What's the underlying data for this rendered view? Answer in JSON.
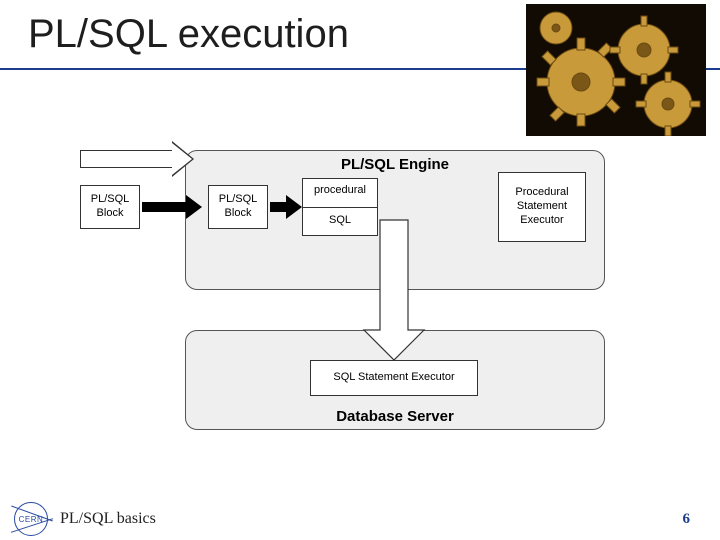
{
  "title": "PL/SQL execution",
  "engine": {
    "label": "PL/SQL Engine"
  },
  "db_server": {
    "label": "Database Server"
  },
  "outer_block": "PL/SQL\nBlock",
  "inner_block": "PL/SQL\nBlock",
  "split": {
    "top": "procedural",
    "bottom": "SQL"
  },
  "proc_exec": "Procedural\nStatement\nExecutor",
  "sql_exec": "SQL Statement Executor",
  "footer": {
    "topic": "PL/SQL basics",
    "page": "6",
    "logo_text": "CERN"
  },
  "image": {
    "alt": "gears"
  }
}
